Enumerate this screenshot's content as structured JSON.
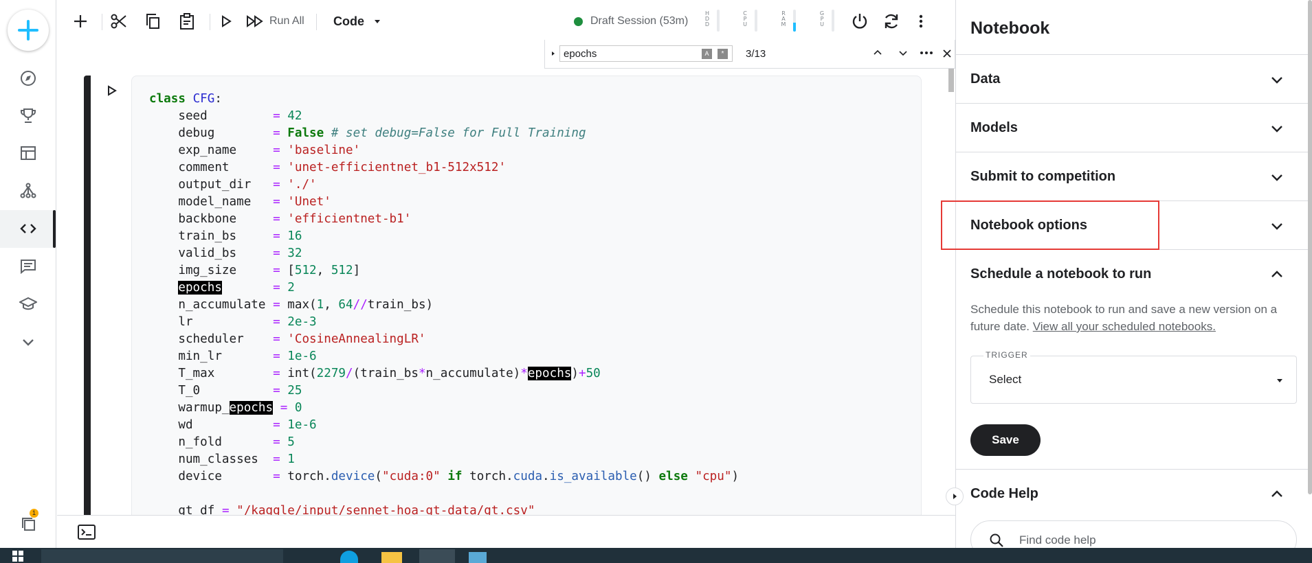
{
  "toolbar": {
    "run_all_label": "Run All",
    "cell_type": "Code",
    "session_status": "Draft Session (53m)",
    "meters": [
      {
        "label": "HDD",
        "level": 0.0,
        "color": "#e8eaed"
      },
      {
        "label": "CPU",
        "level": 0.0,
        "color": "#e8eaed"
      },
      {
        "label": "RAM",
        "level": 0.4,
        "color": "#20beff"
      },
      {
        "label": "GPU",
        "level": 0.0,
        "color": "#e8eaed"
      }
    ]
  },
  "find": {
    "query": "epochs",
    "count": "3/13"
  },
  "code_lines": [
    [
      {
        "t": "class",
        "c": "kw"
      },
      {
        "t": " "
      },
      {
        "t": "CFG",
        "c": "cls"
      },
      {
        "t": ":"
      }
    ],
    [
      {
        "t": "    seed         "
      },
      {
        "t": "=",
        "c": "op"
      },
      {
        "t": " "
      },
      {
        "t": "42",
        "c": "num"
      }
    ],
    [
      {
        "t": "    debug        "
      },
      {
        "t": "=",
        "c": "op"
      },
      {
        "t": " "
      },
      {
        "t": "False",
        "c": "kw"
      },
      {
        "t": " "
      },
      {
        "t": "# set debug=False for Full Training",
        "c": "com"
      }
    ],
    [
      {
        "t": "    exp_name     "
      },
      {
        "t": "=",
        "c": "op"
      },
      {
        "t": " "
      },
      {
        "t": "'baseline'",
        "c": "str"
      }
    ],
    [
      {
        "t": "    comment      "
      },
      {
        "t": "=",
        "c": "op"
      },
      {
        "t": " "
      },
      {
        "t": "'unet-efficientnet_b1-512x512'",
        "c": "str"
      }
    ],
    [
      {
        "t": "    output_dir   "
      },
      {
        "t": "=",
        "c": "op"
      },
      {
        "t": " "
      },
      {
        "t": "'./'",
        "c": "str"
      }
    ],
    [
      {
        "t": "    model_name   "
      },
      {
        "t": "=",
        "c": "op"
      },
      {
        "t": " "
      },
      {
        "t": "'Unet'",
        "c": "str"
      }
    ],
    [
      {
        "t": "    backbone     "
      },
      {
        "t": "=",
        "c": "op"
      },
      {
        "t": " "
      },
      {
        "t": "'efficientnet-b1'",
        "c": "str"
      }
    ],
    [
      {
        "t": "    train_bs     "
      },
      {
        "t": "=",
        "c": "op"
      },
      {
        "t": " "
      },
      {
        "t": "16",
        "c": "num"
      }
    ],
    [
      {
        "t": "    valid_bs     "
      },
      {
        "t": "=",
        "c": "op"
      },
      {
        "t": " "
      },
      {
        "t": "32",
        "c": "num"
      }
    ],
    [
      {
        "t": "    img_size     "
      },
      {
        "t": "=",
        "c": "op"
      },
      {
        "t": " [",
        "c": ""
      },
      {
        "t": "512",
        "c": "num"
      },
      {
        "t": ", "
      },
      {
        "t": "512",
        "c": "num"
      },
      {
        "t": "]"
      }
    ],
    [
      {
        "t": "    "
      },
      {
        "t": "epochs",
        "c": "hl"
      },
      {
        "t": "       "
      },
      {
        "t": "=",
        "c": "op"
      },
      {
        "t": " "
      },
      {
        "t": "2",
        "c": "num"
      }
    ],
    [
      {
        "t": "    n_accumulate "
      },
      {
        "t": "=",
        "c": "op"
      },
      {
        "t": " max("
      },
      {
        "t": "1",
        "c": "num"
      },
      {
        "t": ", "
      },
      {
        "t": "64",
        "c": "num"
      },
      {
        "t": "//",
        "c": "op"
      },
      {
        "t": "train_bs)"
      }
    ],
    [
      {
        "t": "    lr           "
      },
      {
        "t": "=",
        "c": "op"
      },
      {
        "t": " "
      },
      {
        "t": "2e-3",
        "c": "num"
      }
    ],
    [
      {
        "t": "    scheduler    "
      },
      {
        "t": "=",
        "c": "op"
      },
      {
        "t": " "
      },
      {
        "t": "'CosineAnnealingLR'",
        "c": "str"
      }
    ],
    [
      {
        "t": "    min_lr       "
      },
      {
        "t": "=",
        "c": "op"
      },
      {
        "t": " "
      },
      {
        "t": "1e-6",
        "c": "num"
      }
    ],
    [
      {
        "t": "    T_max        "
      },
      {
        "t": "=",
        "c": "op"
      },
      {
        "t": " int("
      },
      {
        "t": "2279",
        "c": "num"
      },
      {
        "t": "/",
        "c": "op"
      },
      {
        "t": "(train_bs"
      },
      {
        "t": "*",
        "c": "op"
      },
      {
        "t": "n_accumulate)"
      },
      {
        "t": "*",
        "c": "op"
      },
      {
        "t": "epochs",
        "c": "hl"
      },
      {
        "t": ")"
      },
      {
        "t": "+",
        "c": "op"
      },
      {
        "t": "50",
        "c": "num"
      }
    ],
    [
      {
        "t": "    T_0          "
      },
      {
        "t": "=",
        "c": "op"
      },
      {
        "t": " "
      },
      {
        "t": "25",
        "c": "num"
      }
    ],
    [
      {
        "t": "    warmup_"
      },
      {
        "t": "epochs",
        "c": "hl"
      },
      {
        "t": " "
      },
      {
        "t": "=",
        "c": "op"
      },
      {
        "t": " "
      },
      {
        "t": "0",
        "c": "num"
      }
    ],
    [
      {
        "t": "    wd           "
      },
      {
        "t": "=",
        "c": "op"
      },
      {
        "t": " "
      },
      {
        "t": "1e-6",
        "c": "num"
      }
    ],
    [
      {
        "t": "    n_fold       "
      },
      {
        "t": "=",
        "c": "op"
      },
      {
        "t": " "
      },
      {
        "t": "5",
        "c": "num"
      }
    ],
    [
      {
        "t": "    num_classes  "
      },
      {
        "t": "=",
        "c": "op"
      },
      {
        "t": " "
      },
      {
        "t": "1",
        "c": "num"
      }
    ],
    [
      {
        "t": "    device       "
      },
      {
        "t": "=",
        "c": "op"
      },
      {
        "t": " torch."
      },
      {
        "t": "device",
        "c": "attr"
      },
      {
        "t": "("
      },
      {
        "t": "\"cuda:0\"",
        "c": "str"
      },
      {
        "t": " "
      },
      {
        "t": "if",
        "c": "kw"
      },
      {
        "t": " torch."
      },
      {
        "t": "cuda",
        "c": "attr"
      },
      {
        "t": "."
      },
      {
        "t": "is_available",
        "c": "attr"
      },
      {
        "t": "() "
      },
      {
        "t": "else",
        "c": "kw"
      },
      {
        "t": " "
      },
      {
        "t": "\"cpu\"",
        "c": "str"
      },
      {
        "t": ")"
      }
    ],
    [
      {
        "t": ""
      }
    ],
    [
      {
        "t": "    gt_df "
      },
      {
        "t": "=",
        "c": "op"
      },
      {
        "t": " "
      },
      {
        "t": "\"/kaggle/input/sennet-hoa-gt-data/gt.csv\"",
        "c": "str"
      }
    ]
  ],
  "panel": {
    "title": "Notebook",
    "sections": [
      {
        "label": "Data"
      },
      {
        "label": "Models"
      },
      {
        "label": "Submit to competition"
      },
      {
        "label": "Notebook options"
      },
      {
        "label": "Schedule a notebook to run"
      }
    ],
    "schedule": {
      "description": "Schedule this notebook to run and save a new version on a future date.",
      "link": "View all your scheduled notebooks.",
      "trigger_label": "TRIGGER",
      "trigger_value": "Select",
      "save_label": "Save"
    },
    "code_help": {
      "title": "Code Help",
      "placeholder": "Find code help"
    }
  },
  "rail": {
    "badge": "1"
  },
  "colors": {
    "accent": "#20beff",
    "session_dot": "#1e8e3e",
    "highlight_box": "#e53935"
  }
}
